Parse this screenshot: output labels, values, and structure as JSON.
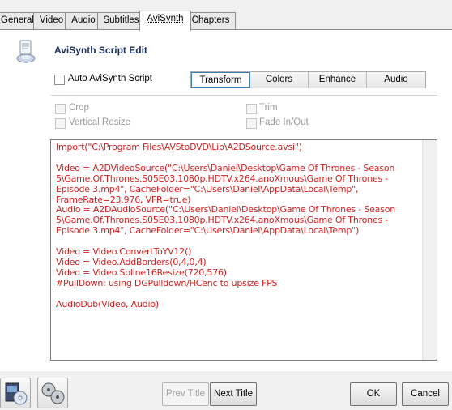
{
  "tabs": [
    {
      "label": "General"
    },
    {
      "label": "Video"
    },
    {
      "label": "Audio"
    },
    {
      "label": "Subtitles"
    },
    {
      "label": "AviSynth"
    },
    {
      "label": "Chapters"
    }
  ],
  "active_tab": "AviSynth",
  "header": {
    "title": "AviSynth Script Edit"
  },
  "auto_script": {
    "label": "Auto AviSynth Script",
    "checked": false
  },
  "segments": [
    {
      "label": "Transform",
      "active": true
    },
    {
      "label": "Colors",
      "active": false
    },
    {
      "label": "Enhance",
      "active": false
    },
    {
      "label": "Audio",
      "active": false
    }
  ],
  "options": {
    "crop": "Crop",
    "vertical_resize": "Vertical Resize",
    "trim": "Trim",
    "fade": "Fade In/Out"
  },
  "script": "Import(\"C:\\Program Files\\AVStoDVD\\Lib\\A2DSource.avsi\")\n\nVideo = A2DVideoSource(\"C:\\Users\\Daniel\\Desktop\\Game Of Thrones - Season 5\\Game.Of.Thrones.S05E03.1080p.HDTV.x264.anoXmous\\Game Of Thrones - Episode 3.mp4\", CacheFolder=\"C:\\Users\\Daniel\\AppData\\Local\\Temp\", FrameRate=23.976, VFR=true)\nAudio = A2DAudioSource(\"C:\\Users\\Daniel\\Desktop\\Game Of Thrones - Season 5\\Game.Of.Thrones.S05E03.1080p.HDTV.x264.anoXmous\\Game Of Thrones - Episode 3.mp4\", CacheFolder=\"C:\\Users\\Daniel\\AppData\\Local\\Temp\")\n\nVideo = Video.ConvertToYV12()\nVideo = Video.AddBorders(0,4,0,4)\nVideo = Video.Spline16Resize(720,576)\n#PullDown: using DGPulldown/HCenc to upsize FPS\n\nAudioDub(Video, Audio)",
  "buttons": {
    "prev_title": "Prev Title",
    "next_title": "Next Title",
    "ok": "OK",
    "cancel": "Cancel"
  },
  "colors": {
    "script_text": "#d81e1e",
    "header_text": "#1e3264"
  }
}
